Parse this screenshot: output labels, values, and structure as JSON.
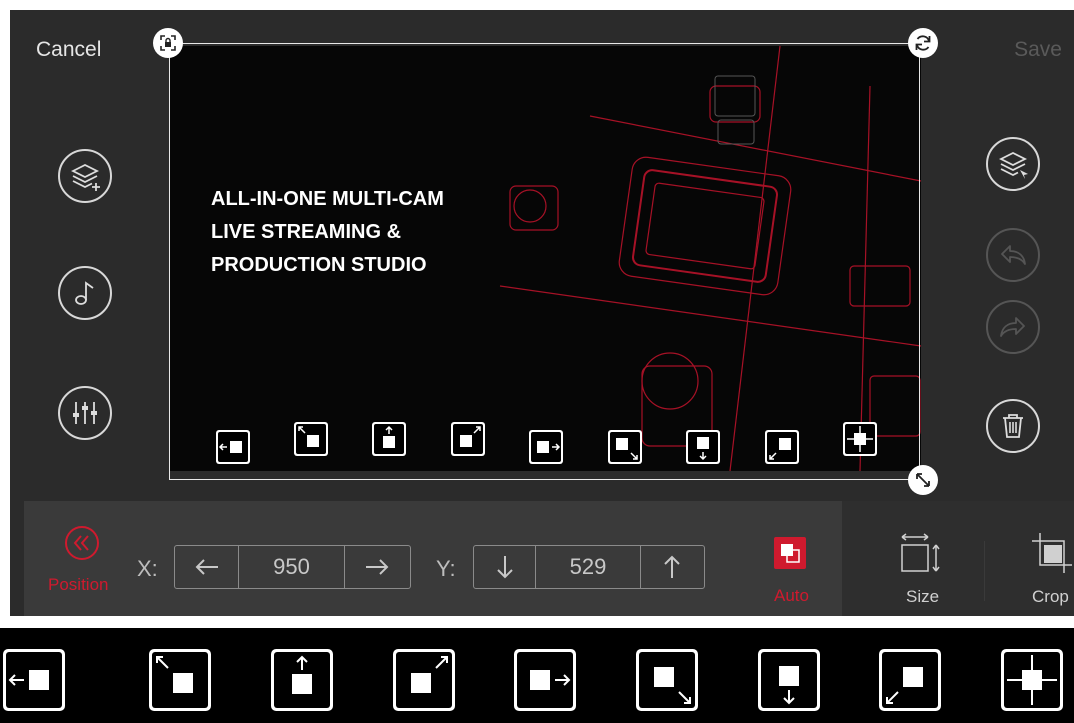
{
  "header": {
    "cancel_label": "Cancel",
    "save_label": "Save"
  },
  "preview": {
    "headline_lines": [
      "ALL-IN-ONE MULTI-CAM",
      "LIVE STREAMING &",
      "PRODUCTION STUDIO"
    ]
  },
  "position_presets": [
    "left-middle",
    "top-left",
    "top-center",
    "top-right",
    "right-middle",
    "bottom-right",
    "bottom-center",
    "bottom-left",
    "center"
  ],
  "toolbar": {
    "position_label": "Position",
    "x_label": "X:",
    "x_value": "950",
    "y_label": "Y:",
    "y_value": "529",
    "auto_label": "Auto",
    "size_label": "Size",
    "crop_label": "Crop"
  },
  "colors": {
    "accent": "#cf1a2e",
    "background": "#2b2b2b",
    "panel": "#3a3a3a"
  },
  "icons": {
    "left_sidebar": [
      "add-layer-icon",
      "music-note-icon",
      "mixer-sliders-icon"
    ],
    "right_sidebar": [
      "select-layer-icon",
      "undo-icon",
      "redo-icon",
      "trash-icon"
    ]
  }
}
